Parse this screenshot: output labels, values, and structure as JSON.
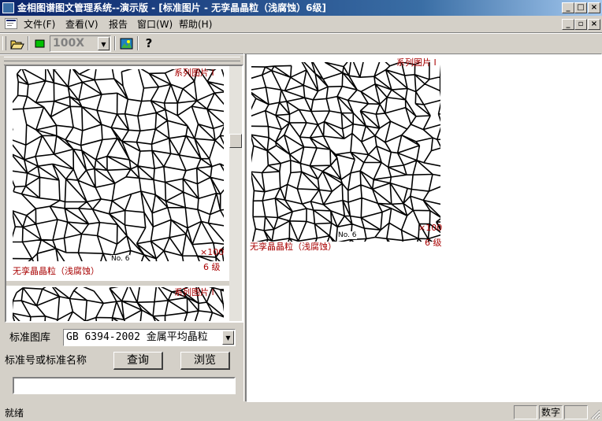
{
  "window": {
    "title": "金相图谱图文管理系统--演示版 - [标准图片 - 无孪晶晶粒（浅腐蚀）6级]",
    "caption_minimize": "_",
    "caption_maximize": "□",
    "caption_close": "×",
    "mdi_minimize": "_",
    "mdi_restore": "▫",
    "mdi_close": "×"
  },
  "menu": {
    "items": [
      {
        "label": "文件(F)"
      },
      {
        "label": "查看(V)"
      },
      {
        "label": "报告"
      },
      {
        "label": "窗口(W)"
      },
      {
        "label": "帮助(H)"
      }
    ]
  },
  "toolbar": {
    "zoom_value": "100X",
    "help_symbol": "?",
    "icons": [
      "open-folder-icon",
      "green-square-icon",
      "image-icon",
      "help-icon"
    ]
  },
  "left_panel": {
    "thumbnails": [
      {
        "header": "系列图片 I",
        "magnification": "×100",
        "grade": "6 级",
        "number_label": "No. 6",
        "caption": "无孪晶晶粒（浅腐蚀）"
      },
      {
        "header": "系列图片 I"
      }
    ],
    "library_label": "标准图库",
    "library_value": "GB 6394-2002 金属平均晶粒",
    "standard_name_label": "标准号或标准名称",
    "query_button": "查询",
    "browse_button": "浏览",
    "search_value": ""
  },
  "right_panel": {
    "header": "系列图片 I",
    "magnification": "×100",
    "grade": "6 级",
    "number_label": "No. 6",
    "caption": "无孪晶晶粒（浅腐蚀）"
  },
  "status": {
    "left": "就绪",
    "num": "数字"
  },
  "colors": {
    "titlebar_start": "#0a246a",
    "titlebar_end": "#a6caf0",
    "face": "#d4d0c8",
    "caption_red": "#a80000"
  }
}
